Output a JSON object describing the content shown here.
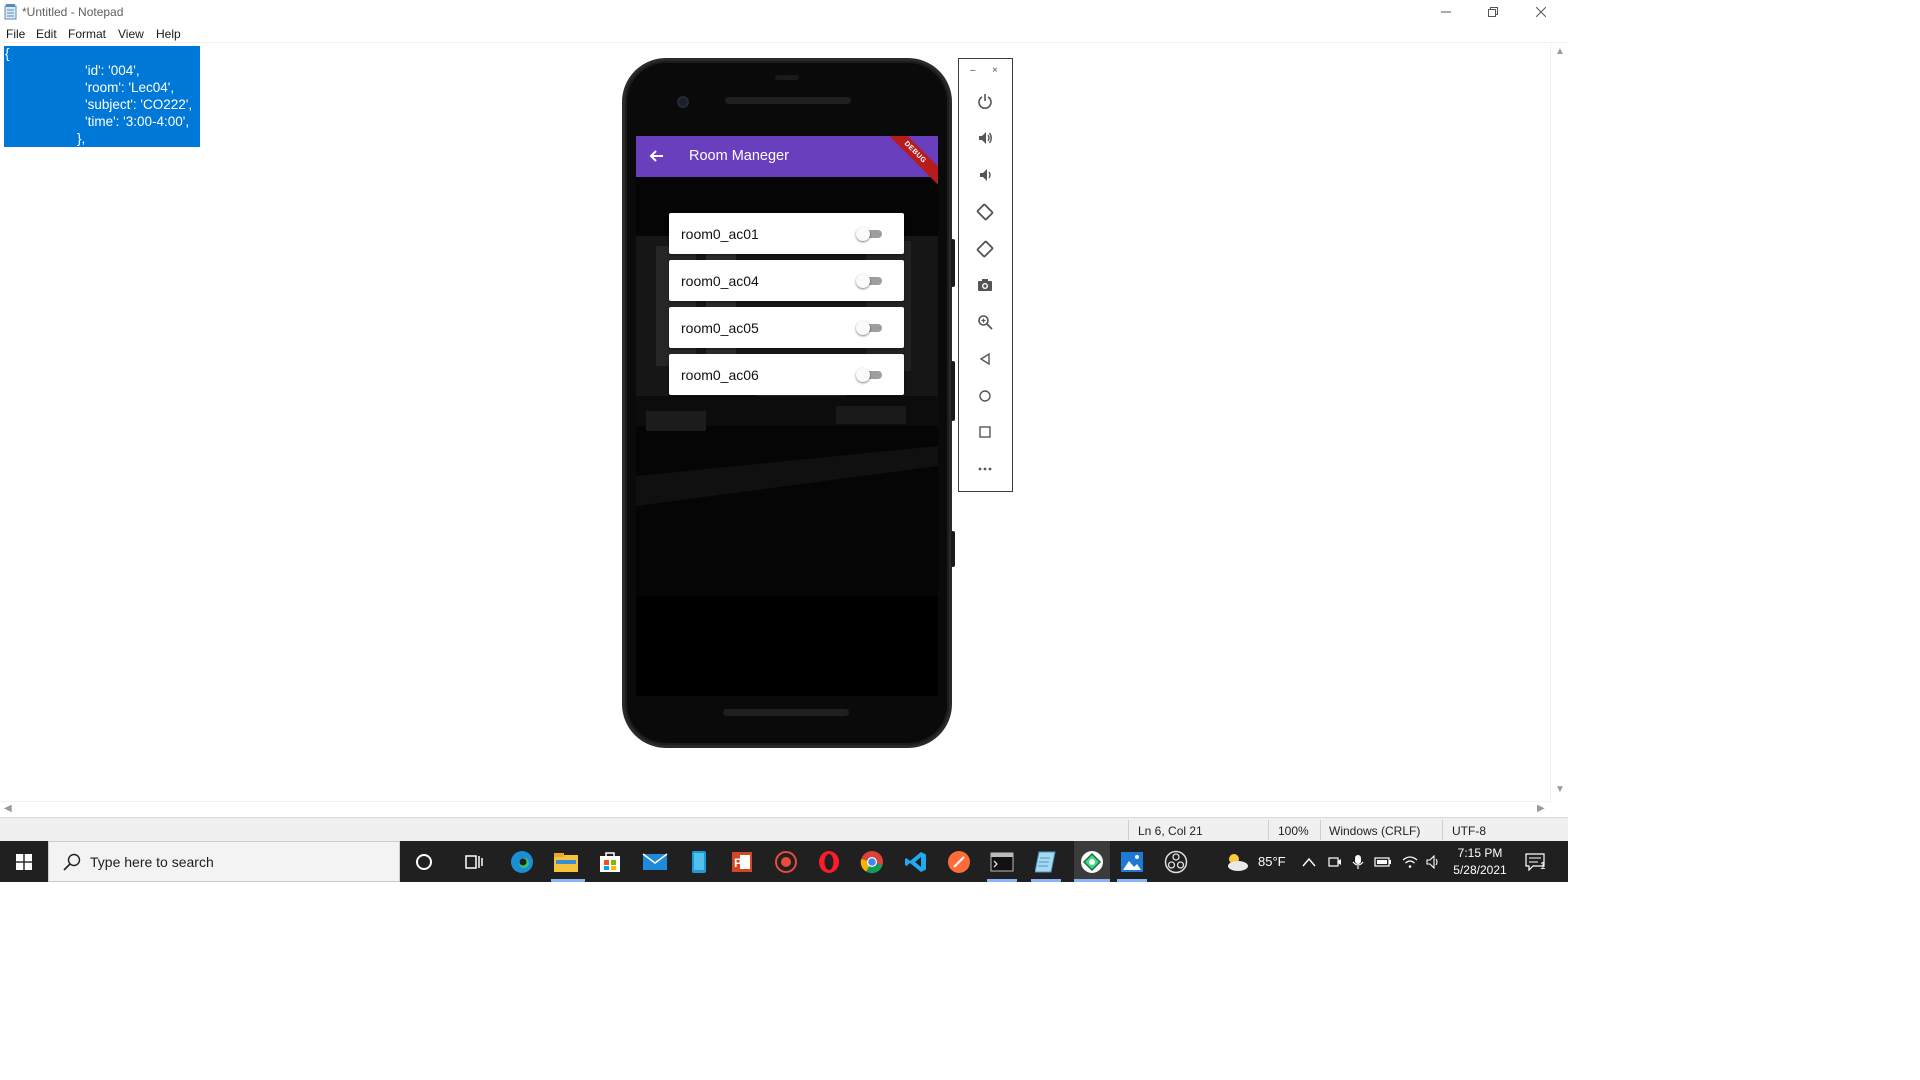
{
  "window": {
    "title": "*Untitled - Notepad",
    "menu": [
      "File",
      "Edit",
      "Format",
      "View",
      "Help"
    ]
  },
  "editor": {
    "lines": [
      "{",
      "'id': '004',",
      "'room': 'Lec04',",
      "'subject': 'CO222',",
      "'time': '3:00-4:00',",
      "},"
    ]
  },
  "statusbar": {
    "position": "Ln 6, Col 21",
    "zoom": "100%",
    "line_ending": "Windows (CRLF)",
    "encoding": "UTF-8"
  },
  "phone": {
    "app_title": "Room Maneger",
    "debug_label": "DEBUG",
    "accent_color": "#6a3fbe",
    "rooms": [
      {
        "name": "room0_ac01",
        "on": false
      },
      {
        "name": "room0_ac04",
        "on": false
      },
      {
        "name": "room0_ac05",
        "on": false
      },
      {
        "name": "room0_ac06",
        "on": false
      }
    ]
  },
  "emulator_toolbar": {
    "minimize": "–",
    "close": "×",
    "buttons": [
      "power-icon",
      "volume-up-icon",
      "volume-down-icon",
      "rotate-left-icon",
      "rotate-right-icon",
      "camera-icon",
      "zoom-icon",
      "back-icon",
      "home-icon",
      "overview-icon",
      "more-icon"
    ]
  },
  "taskbar": {
    "search_placeholder": "Type here to search",
    "weather": "85°F",
    "time": "7:15 PM",
    "date": "5/28/2021",
    "notifications": "1"
  }
}
